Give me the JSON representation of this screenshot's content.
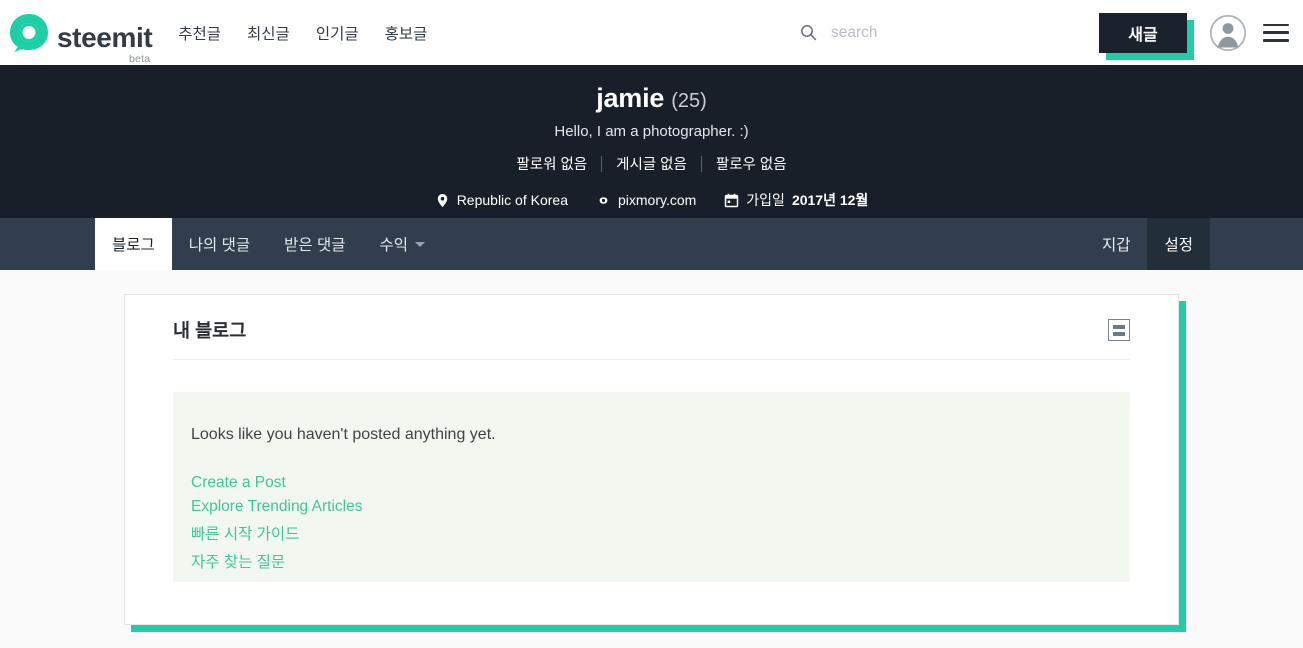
{
  "header": {
    "brand_name": "steemit",
    "brand_beta": "beta",
    "logo_icon": "steemit-logo-icon",
    "nav": [
      {
        "label": "추천글"
      },
      {
        "label": "최신글"
      },
      {
        "label": "인기글"
      },
      {
        "label": "홍보글"
      }
    ],
    "search": {
      "icon": "search-icon",
      "placeholder": "search",
      "value": ""
    },
    "submit_label": "새글",
    "avatar_icon": "user-avatar-icon",
    "menu_icon": "hamburger-menu-icon"
  },
  "profile": {
    "name": "jamie",
    "reputation": "(25)",
    "about": "Hello, I am a photographer. :)",
    "stats": [
      {
        "label": "팔로워 없음"
      },
      {
        "label": "게시글 없음"
      },
      {
        "label": "팔로우 없음"
      }
    ],
    "meta": {
      "location_icon": "location-pin-icon",
      "location": "Republic of Korea",
      "website_icon": "link-chain-icon",
      "website": "pixmory.com",
      "joined_icon": "calendar-icon",
      "joined_prefix": "가입일",
      "joined_date": "2017년 12월"
    }
  },
  "tabs": {
    "left": [
      {
        "label": "블로그",
        "state": "active"
      },
      {
        "label": "나의 댓글",
        "state": "normal"
      },
      {
        "label": "받은 댓글",
        "state": "normal"
      },
      {
        "label": "수익",
        "state": "normal",
        "has_caret": true
      }
    ],
    "right": [
      {
        "label": "지갑",
        "state": "normal"
      },
      {
        "label": "설정",
        "state": "hovered"
      }
    ]
  },
  "main": {
    "card_title": "내 블로그",
    "viewmode_icon": "list-view-toggle-icon",
    "empty_message": "Looks like you haven't posted anything yet.",
    "empty_links": [
      {
        "label": "Create a Post"
      },
      {
        "label": "Explore Trending Articles"
      },
      {
        "label": "빠른 시작 가이드"
      },
      {
        "label": "자주 찾는 질문"
      }
    ]
  },
  "colors": {
    "accent_green": "#1ecfa5",
    "link_green": "#3ec79a",
    "banner_dark": "#181f29",
    "tabbar_dark": "#313e4d",
    "panel_bg": "#f2f8f0"
  }
}
